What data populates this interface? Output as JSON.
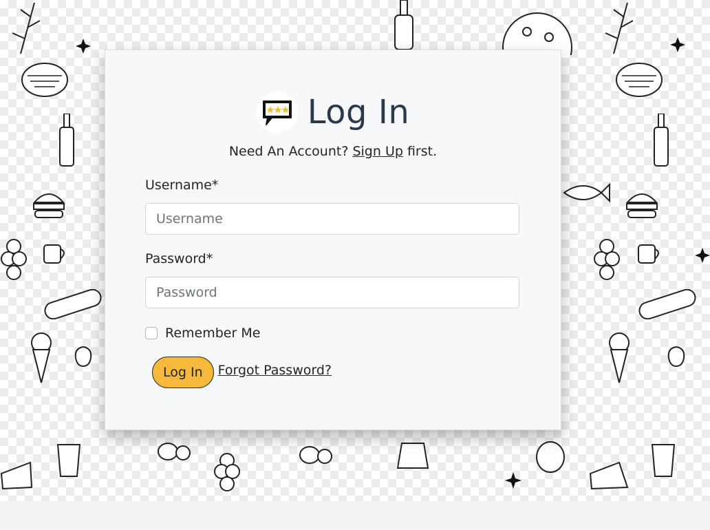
{
  "login": {
    "title": "Log In",
    "need_account_text": "Need An Account?",
    "signup_link": "Sign Up",
    "signup_suffix": "first.",
    "username_label": "Username*",
    "username_placeholder": "Username",
    "username_value": "",
    "password_label": "Password*",
    "password_placeholder": "Password",
    "password_value": "",
    "remember_label": "Remember Me",
    "remember_checked": false,
    "login_button": "Log In",
    "forgot_link": "Forgot Password?"
  },
  "icons": {
    "logo": "rating-chat-bubble-icon"
  },
  "colors": {
    "primary_button": "#f6b93b",
    "title_text": "#2b3a4a",
    "card_background": "#f7f8f9",
    "logo_star": "#f6b93b"
  }
}
